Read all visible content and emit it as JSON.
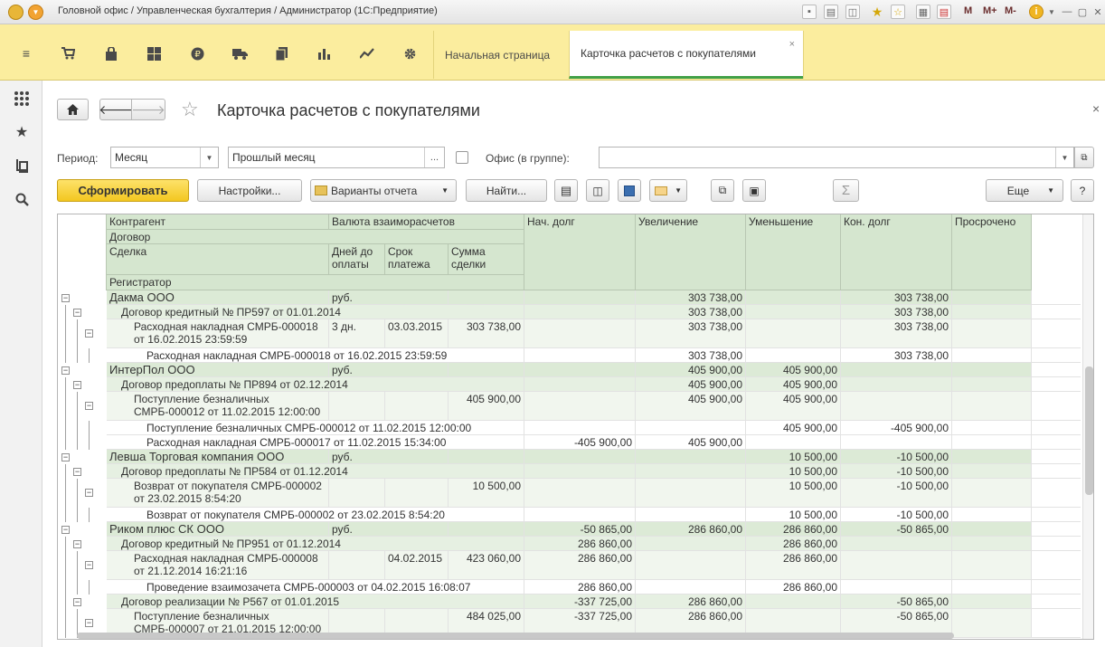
{
  "window": {
    "title": "Головной офис / Управленческая бухгалтерия / Администратор  (1С:Предприятие)"
  },
  "titlebar_tools": {
    "m": "M",
    "m_plus": "M+",
    "m_minus": "M-"
  },
  "tabs": {
    "home": "Начальная страница",
    "active": "Карточка расчетов с покупателями",
    "close": "×"
  },
  "page": {
    "title": "Карточка расчетов с покупателями",
    "close": "×"
  },
  "filters": {
    "period_label": "Период:",
    "period_value": "Месяц",
    "range_value": "Прошлый месяц",
    "range_button": "...",
    "office_label": "Офис (в группе):",
    "office_value": ""
  },
  "toolbar": {
    "generate": "Сформировать",
    "settings": "Настройки...",
    "variants": "Варианты отчета",
    "find": "Найти...",
    "more": "Еще",
    "help": "?",
    "sum": "Σ"
  },
  "report_header": {
    "counterparty": "Контрагент",
    "currency": "Валюта взаиморасчетов",
    "contract": "Договор",
    "deal": "Сделка",
    "days_to_pay": "Дней до оплаты",
    "due_date": "Срок платежа",
    "deal_sum": "Сумма сделки",
    "registrar": "Регистратор",
    "opening_debt": "Нач. долг",
    "increase": "Увеличение",
    "decrease": "Уменьшение",
    "closing_debt": "Кон. долг",
    "overdue": "Просрочено"
  },
  "rows": [
    {
      "level": 0,
      "label": "Дакма ООО",
      "currency": "руб.",
      "days": "",
      "due": "",
      "sum": "",
      "open": "",
      "inc": "303 738,00",
      "dec": "",
      "close": "303 738,00",
      "overdue": ""
    },
    {
      "level": 1,
      "label": "Договор кредитный № ПР597 от 01.01.2014",
      "currency": "",
      "days": "",
      "due": "",
      "sum": "",
      "open": "",
      "inc": "303 738,00",
      "dec": "",
      "close": "303 738,00",
      "overdue": ""
    },
    {
      "level": 2,
      "label": "Расходная накладная СМРБ-000018 от 16.02.2015 23:59:59",
      "currency": "",
      "days": "3 дн.",
      "due": "03.03.2015",
      "sum": "303 738,00",
      "open": "",
      "inc": "303 738,00",
      "dec": "",
      "close": "303 738,00",
      "overdue": ""
    },
    {
      "level": 3,
      "label": "Расходная накладная СМРБ-000018 от 16.02.2015 23:59:59",
      "currency": "",
      "days": "",
      "due": "",
      "sum": "",
      "open": "",
      "inc": "303 738,00",
      "dec": "",
      "close": "303 738,00",
      "overdue": ""
    },
    {
      "level": 0,
      "label": "ИнтерПол ООО",
      "currency": "руб.",
      "days": "",
      "due": "",
      "sum": "",
      "open": "",
      "inc": "405 900,00",
      "dec": "405 900,00",
      "close": "",
      "overdue": ""
    },
    {
      "level": 1,
      "label": "Договор предоплаты № ПР894 от 02.12.2014",
      "currency": "",
      "days": "",
      "due": "",
      "sum": "",
      "open": "",
      "inc": "405 900,00",
      "dec": "405 900,00",
      "close": "",
      "overdue": ""
    },
    {
      "level": 2,
      "label": "Поступление безналичных СМРБ-000012 от 11.02.2015 12:00:00",
      "currency": "",
      "days": "",
      "due": "",
      "sum": "405 900,00",
      "open": "",
      "inc": "405 900,00",
      "dec": "405 900,00",
      "close": "",
      "overdue": ""
    },
    {
      "level": 3,
      "label": "Поступление безналичных СМРБ-000012 от 11.02.2015 12:00:00",
      "currency": "",
      "days": "",
      "due": "",
      "sum": "",
      "open": "",
      "inc": "",
      "dec": "405 900,00",
      "close": "-405 900,00",
      "overdue": ""
    },
    {
      "level": 3,
      "label": "Расходная накладная СМРБ-000017 от 11.02.2015 15:34:00",
      "currency": "",
      "days": "",
      "due": "",
      "sum": "",
      "open": "-405 900,00",
      "inc": "405 900,00",
      "dec": "",
      "close": "",
      "overdue": ""
    },
    {
      "level": 0,
      "label": "Левша Торговая компания ООО",
      "currency": "руб.",
      "days": "",
      "due": "",
      "sum": "",
      "open": "",
      "inc": "",
      "dec": "10 500,00",
      "close": "-10 500,00",
      "overdue": ""
    },
    {
      "level": 1,
      "label": "Договор предоплаты № ПР584 от 01.12.2014",
      "currency": "",
      "days": "",
      "due": "",
      "sum": "",
      "open": "",
      "inc": "",
      "dec": "10 500,00",
      "close": "-10 500,00",
      "overdue": ""
    },
    {
      "level": 2,
      "label": "Возврат от покупателя СМРБ-000002 от 23.02.2015 8:54:20",
      "currency": "",
      "days": "",
      "due": "",
      "sum": "10 500,00",
      "open": "",
      "inc": "",
      "dec": "10 500,00",
      "close": "-10 500,00",
      "overdue": ""
    },
    {
      "level": 3,
      "label": "Возврат от покупателя СМРБ-000002 от 23.02.2015 8:54:20",
      "currency": "",
      "days": "",
      "due": "",
      "sum": "",
      "open": "",
      "inc": "",
      "dec": "10 500,00",
      "close": "-10 500,00",
      "overdue": ""
    },
    {
      "level": 0,
      "label": "Риком плюс СК ООО",
      "currency": "руб.",
      "days": "",
      "due": "",
      "sum": "",
      "open": "-50 865,00",
      "inc": "286 860,00",
      "dec": "286 860,00",
      "close": "-50 865,00",
      "overdue": ""
    },
    {
      "level": 1,
      "label": "Договор кредитный № ПР951 от 01.12.2014",
      "currency": "",
      "days": "",
      "due": "",
      "sum": "",
      "open": "286 860,00",
      "inc": "",
      "dec": "286 860,00",
      "close": "",
      "overdue": ""
    },
    {
      "level": 2,
      "label": "Расходная накладная СМРБ-000008 от 21.12.2014 16:21:16",
      "currency": "",
      "days": "",
      "due": "04.02.2015",
      "sum": "423 060,00",
      "open": "286 860,00",
      "inc": "",
      "dec": "286 860,00",
      "close": "",
      "overdue": ""
    },
    {
      "level": 3,
      "label": "Проведение взаимозачета СМРБ-000003 от 04.02.2015 16:08:07",
      "currency": "",
      "days": "",
      "due": "",
      "sum": "",
      "open": "286 860,00",
      "inc": "",
      "dec": "286 860,00",
      "close": "",
      "overdue": ""
    },
    {
      "level": 1,
      "label": "Договор реализации № Р567 от 01.01.2015",
      "currency": "",
      "days": "",
      "due": "",
      "sum": "",
      "open": "-337 725,00",
      "inc": "286 860,00",
      "dec": "",
      "close": "-50 865,00",
      "overdue": ""
    },
    {
      "level": 2,
      "label": "Поступление безналичных СМРБ-000007 от 21.01.2015 12:00:00",
      "currency": "",
      "days": "",
      "due": "",
      "sum": "484 025,00",
      "open": "-337 725,00",
      "inc": "286 860,00",
      "dec": "",
      "close": "-50 865,00",
      "overdue": ""
    }
  ],
  "colors": {
    "panel": "#fbed9e",
    "header_bg": "#d5e6cf",
    "row_lvl0": "#dcead6",
    "row_lvl1": "#e6f0e2",
    "row_lvl2": "#f1f6ee",
    "row_lvl3": "#ffffff",
    "primary_button": "#f8cf2a",
    "active_tab_line": "#41a047"
  }
}
